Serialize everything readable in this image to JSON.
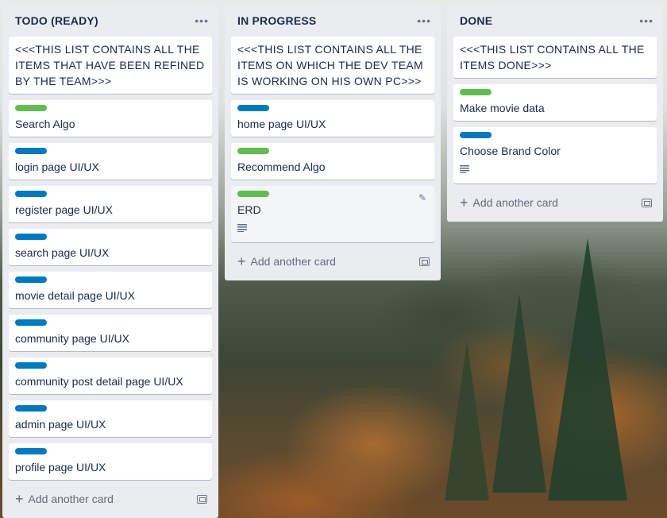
{
  "colors": {
    "green": "#61bd4f",
    "blue": "#0079bf"
  },
  "lists": [
    {
      "title": "TODO (READY)",
      "add_label": "Add another card",
      "cards": [
        {
          "title": "<<<THIS LIST CONTAINS ALL THE ITEMS THAT HAVE BEEN REFINED BY THE TEAM>>>",
          "label": null
        },
        {
          "title": "Search Algo",
          "label": "green"
        },
        {
          "title": "login page UI/UX",
          "label": "blue"
        },
        {
          "title": "register page UI/UX",
          "label": "blue"
        },
        {
          "title": "search page UI/UX",
          "label": "blue"
        },
        {
          "title": "movie detail page UI/UX",
          "label": "blue"
        },
        {
          "title": "community page UI/UX",
          "label": "blue"
        },
        {
          "title": "community post detail page UI/UX",
          "label": "blue"
        },
        {
          "title": "admin page UI/UX",
          "label": "blue"
        },
        {
          "title": "profile page UI/UX",
          "label": "blue"
        }
      ]
    },
    {
      "title": "IN PROGRESS",
      "add_label": "Add another card",
      "cards": [
        {
          "title": "<<<THIS LIST CONTAINS ALL THE ITEMS ON WHICH THE DEV TEAM IS WORKING ON HIS OWN PC>>>",
          "label": null
        },
        {
          "title": "home page UI/UX",
          "label": "blue"
        },
        {
          "title": "Recommend Algo",
          "label": "green"
        },
        {
          "title": "ERD",
          "label": "green",
          "has_description": true,
          "hovered": true
        }
      ]
    },
    {
      "title": "DONE",
      "add_label": "Add another card",
      "cards": [
        {
          "title": "<<<THIS LIST CONTAINS ALL THE ITEMS DONE>>>",
          "label": null
        },
        {
          "title": "Make movie data",
          "label": "green"
        },
        {
          "title": "Choose Brand Color",
          "label": "blue",
          "has_description": true
        }
      ]
    }
  ]
}
